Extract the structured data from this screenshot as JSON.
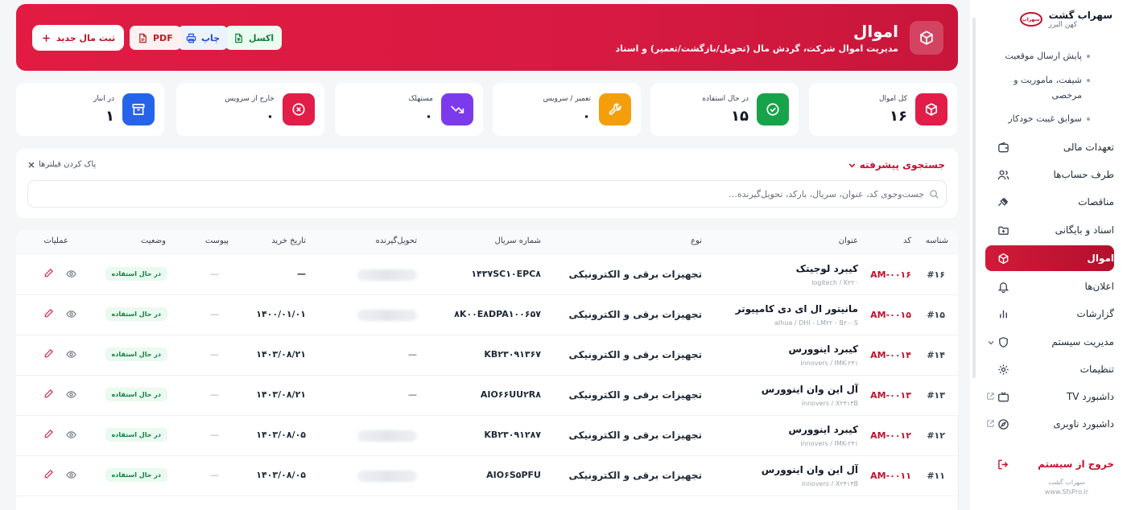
{
  "sidebar": {
    "brand_name": "سهراب گشت",
    "brand_sub": "کهن البرز",
    "brand_logo_text": "سهراب",
    "sub_items": [
      {
        "label": "پایش ارسال موقعیت"
      },
      {
        "label": "شیفت، ماموریت و مرخصی"
      },
      {
        "label": "سوابق غیبت خودکار"
      }
    ],
    "items": [
      {
        "label": "تعهدات مالی",
        "icon": "wallet-icon"
      },
      {
        "label": "طرف حساب‌ها",
        "icon": "users-icon"
      },
      {
        "label": "مناقصات",
        "icon": "gavel-icon"
      },
      {
        "label": "اسناد و بایگانی",
        "icon": "folder-icon"
      },
      {
        "label": "اموال",
        "icon": "box-icon",
        "active": true
      },
      {
        "label": "اعلان‌ها",
        "icon": "bell-icon"
      },
      {
        "label": "گزارشات",
        "icon": "bar-chart-icon"
      },
      {
        "label": "مدیریت سیستم",
        "icon": "shield-icon"
      },
      {
        "label": "تنظیمات",
        "icon": "gear-icon"
      },
      {
        "label": "داشبورد TV",
        "icon": "tv-icon"
      },
      {
        "label": "داشبورد ناوبری",
        "icon": "compass-icon"
      }
    ],
    "logout": "خروج از سیستم",
    "footer_line1": "سهراب گشت",
    "footer_line2": "www.SfsPro.ir"
  },
  "header": {
    "title": "اموال",
    "subtitle": "مدیریت اموال شرکت، گردش مال (تحویل/بازگشت/تعمیر) و اسناد",
    "btn_excel": "اکسل",
    "btn_print": "چاپ",
    "btn_pdf": "PDF",
    "btn_new": "ثبت مال جدید"
  },
  "stats": [
    {
      "label": "کل اموال",
      "value": "۱۶",
      "color": "#e11d48",
      "icon": "box-icon"
    },
    {
      "label": "در حال استفاده",
      "value": "۱۵",
      "color": "#16a34a",
      "icon": "check-circle-icon"
    },
    {
      "label": "تعمیر / سرویس",
      "value": "۰",
      "color": "#f59e0b",
      "icon": "wrench-icon"
    },
    {
      "label": "مستهلک",
      "value": "۰",
      "color": "#7c3aed",
      "icon": "trend-down-icon"
    },
    {
      "label": "خارج از سرویس",
      "value": "۰",
      "color": "#e11d48",
      "icon": "x-circle-icon"
    },
    {
      "label": "در انبار",
      "value": "۱",
      "color": "#2563eb",
      "icon": "archive-icon"
    }
  ],
  "search": {
    "advanced_label": "جستجوی پیشرفته",
    "clear_label": "پاک کردن فیلترها",
    "placeholder": "جست‌وجوی کد، عنوان، سریال، بارکد، تحویل‌گیرنده..."
  },
  "table": {
    "columns": {
      "idx": "شناسه",
      "code": "کد",
      "title": "عنوان",
      "type": "نوع",
      "serial": "شماره سریال",
      "receiver": "تحویل‌گیرنده",
      "date": "تاریخ خرید",
      "attach": "پیوست",
      "status": "وضعیت",
      "actions": "عملیات"
    },
    "rows": [
      {
        "idx": "#۱۶",
        "code": "AM-۰۰۱۶",
        "title": "کیبرد لوجیتک",
        "sub": "logitech / K۲۲۰",
        "type": "تجهیزات برقی و الکترونیکی",
        "serial": "۱۴۳۷SC۱۰EPC۸",
        "receiver": "",
        "date": "—",
        "attach": "—",
        "status": "در حال استفاده"
      },
      {
        "idx": "#۱۵",
        "code": "AM-۰۰۱۵",
        "title": "مانیتور ال ای دی کامپیوتر",
        "sub": "alhua / DHI - LM۲۲ - B۲۰۰S",
        "type": "تجهیزات برقی و الکترونیکی",
        "serial": "۸K۰۰E۸DPA۱۰۰۶۵۷",
        "receiver": "",
        "date": "۱۴۰۰/۰۱/۰۱",
        "attach": "—",
        "status": "در حال استفاده"
      },
      {
        "idx": "#۱۴",
        "code": "AM-۰۰۱۴",
        "title": "کیبرد اینوورس",
        "sub": "innovers / IMK-۲۴۱",
        "type": "تجهیزات برقی و الکترونیکی",
        "serial": "KB۲۳۰۹۱۳۶۷",
        "receiver": "—",
        "date": "۱۴۰۳/۰۸/۲۱",
        "attach": "—",
        "status": "در حال استفاده"
      },
      {
        "idx": "#۱۳",
        "code": "AM-۰۰۱۳",
        "title": "آل این وان اینوورس",
        "sub": "innovers / X۲۴۱۴B",
        "type": "تجهیزات برقی و الکترونیکی",
        "serial": "AIO۶۶UU۲R۸",
        "receiver": "—",
        "date": "۱۴۰۳/۰۸/۲۱",
        "attach": "—",
        "status": "در حال استفاده"
      },
      {
        "idx": "#۱۲",
        "code": "AM-۰۰۱۲",
        "title": "کیبرد اینوورس",
        "sub": "innovers / IMK-۲۴۱",
        "type": "تجهیزات برقی و الکترونیکی",
        "serial": "KB۲۳۰۹۱۲۸۷",
        "receiver": "",
        "date": "۱۴۰۳/۰۸/۰۵",
        "attach": "—",
        "status": "در حال استفاده"
      },
      {
        "idx": "#۱۱",
        "code": "AM-۰۰۱۱",
        "title": "آل این وان اینوورس",
        "sub": "innovers / X۲۴۱۴B",
        "type": "تجهیزات برقی و الکترونیکی",
        "serial": "AIO۶S۵PFU",
        "receiver": "",
        "date": "۱۴۰۳/۰۸/۰۵",
        "attach": "—",
        "status": "در حال استفاده"
      }
    ]
  }
}
